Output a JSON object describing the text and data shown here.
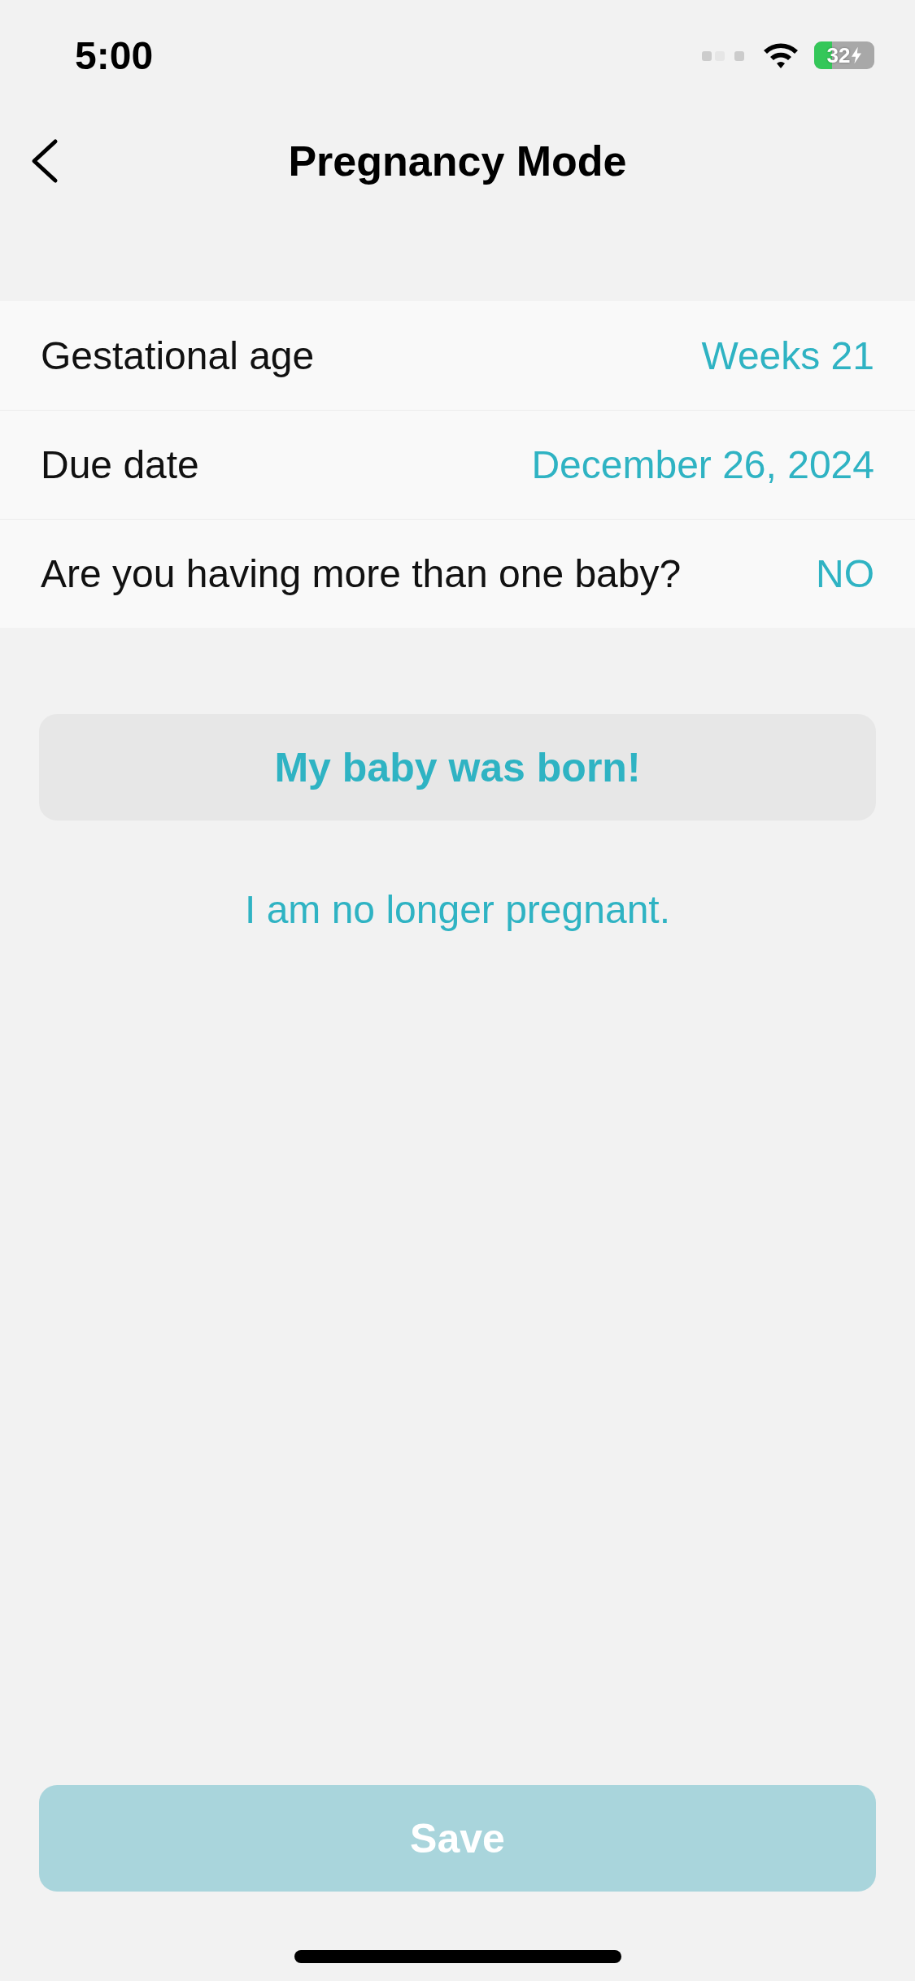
{
  "status_bar": {
    "time": "5:00",
    "battery": "32"
  },
  "nav": {
    "title": "Pregnancy Mode"
  },
  "rows": [
    {
      "label": "Gestational age",
      "value": "Weeks 21"
    },
    {
      "label": "Due date",
      "value": "December 26, 2024"
    },
    {
      "label": "Are you having more than one baby?",
      "value": "NO"
    }
  ],
  "born_button": {
    "label": "My baby was born!"
  },
  "no_longer_link": {
    "label": "I am no longer pregnant."
  },
  "save_button": {
    "label": "Save",
    "disabled": true
  }
}
